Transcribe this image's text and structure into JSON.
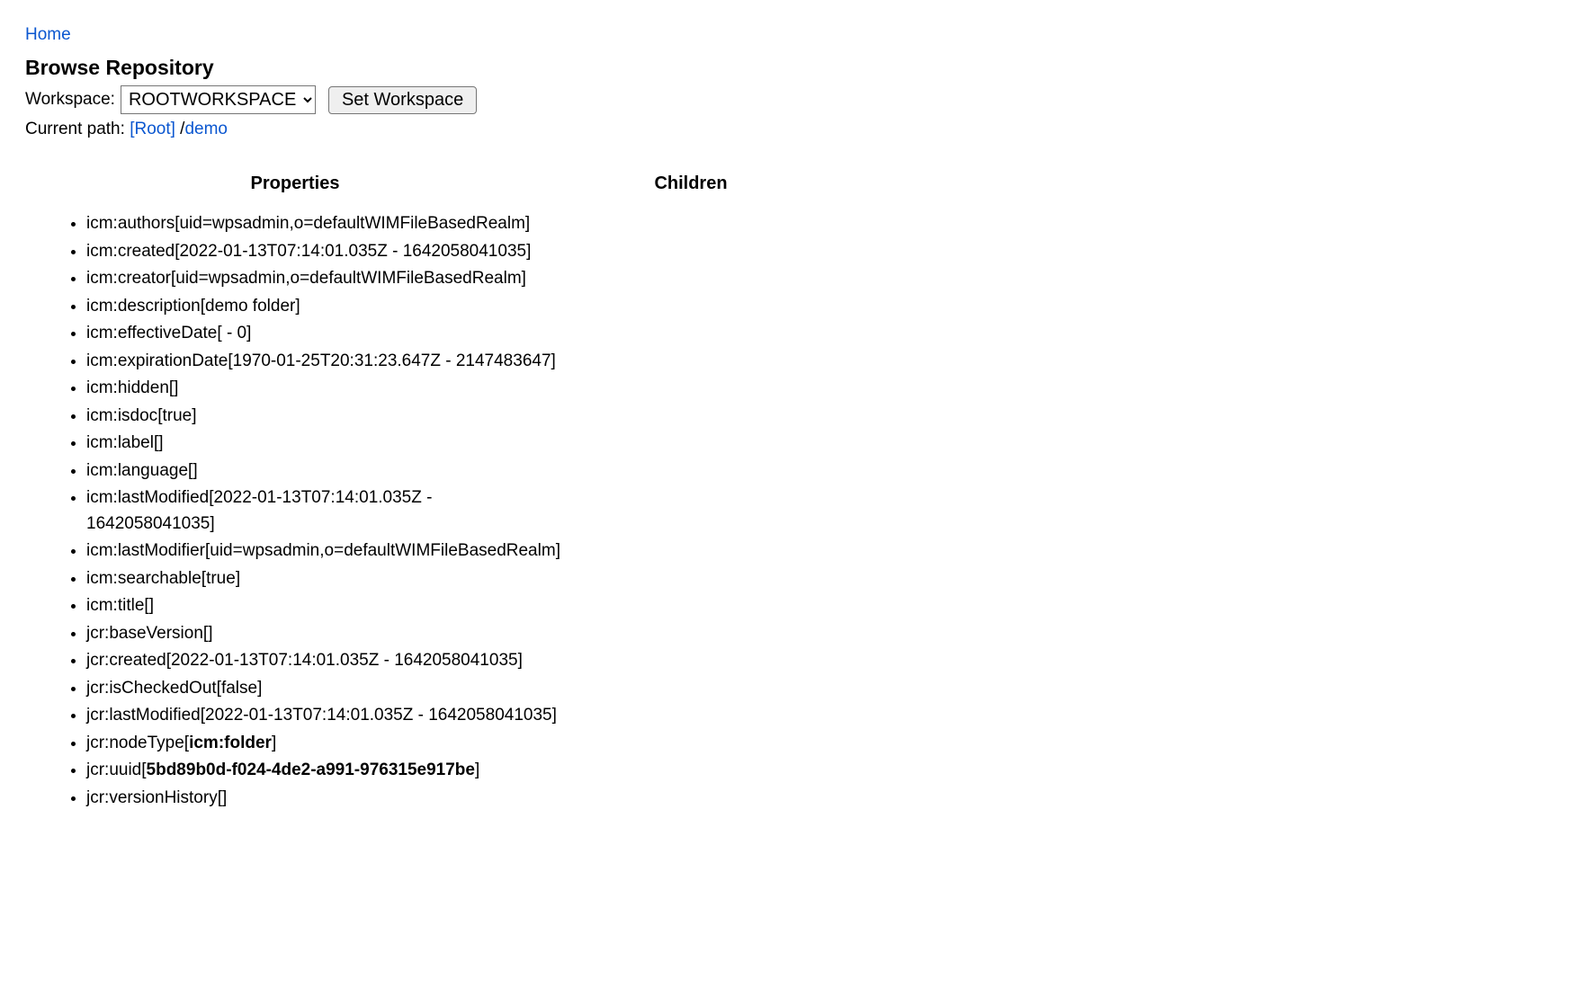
{
  "nav": {
    "home_label": "Home"
  },
  "header": {
    "title": "Browse Repository",
    "workspace_label": "Workspace:",
    "workspace_selected": "ROOTWORKSPACE",
    "set_button_label": "Set Workspace",
    "current_path_label": "Current path:",
    "path_root_label": "[Root]",
    "path_sep": " /",
    "path_node_label": "demo"
  },
  "sections": {
    "properties_title": "Properties",
    "children_title": "Children"
  },
  "properties": [
    {
      "key": "icm:authors",
      "value": "uid=wpsadmin,o=defaultWIMFileBasedRealm"
    },
    {
      "key": "icm:created",
      "value": "2022-01-13T07:14:01.035Z - 1642058041035"
    },
    {
      "key": "icm:creator",
      "value": "uid=wpsadmin,o=defaultWIMFileBasedRealm"
    },
    {
      "key": "icm:description",
      "value": "demo folder"
    },
    {
      "key": "icm:effectiveDate",
      "value": " - 0"
    },
    {
      "key": "icm:expirationDate",
      "value": "1970-01-25T20:31:23.647Z - 2147483647"
    },
    {
      "key": "icm:hidden",
      "value": ""
    },
    {
      "key": "icm:isdoc",
      "value": "true"
    },
    {
      "key": "icm:label",
      "value": ""
    },
    {
      "key": "icm:language",
      "value": ""
    },
    {
      "key": "icm:lastModified",
      "value": "2022-01-13T07:14:01.035Z - 1642058041035"
    },
    {
      "key": "icm:lastModifier",
      "value": "uid=wpsadmin,o=defaultWIMFileBasedRealm"
    },
    {
      "key": "icm:searchable",
      "value": "true"
    },
    {
      "key": "icm:title",
      "value": ""
    },
    {
      "key": "jcr:baseVersion",
      "value": ""
    },
    {
      "key": "jcr:created",
      "value": "2022-01-13T07:14:01.035Z - 1642058041035"
    },
    {
      "key": "jcr:isCheckedOut",
      "value": "false"
    },
    {
      "key": "jcr:lastModified",
      "value": "2022-01-13T07:14:01.035Z - 1642058041035"
    },
    {
      "key": "jcr:nodeType",
      "value": "icm:folder",
      "bold": true
    },
    {
      "key": "jcr:uuid",
      "value": "5bd89b0d-f024-4de2-a991-976315e917be",
      "bold": true
    },
    {
      "key": "jcr:versionHistory",
      "value": ""
    }
  ],
  "children": []
}
